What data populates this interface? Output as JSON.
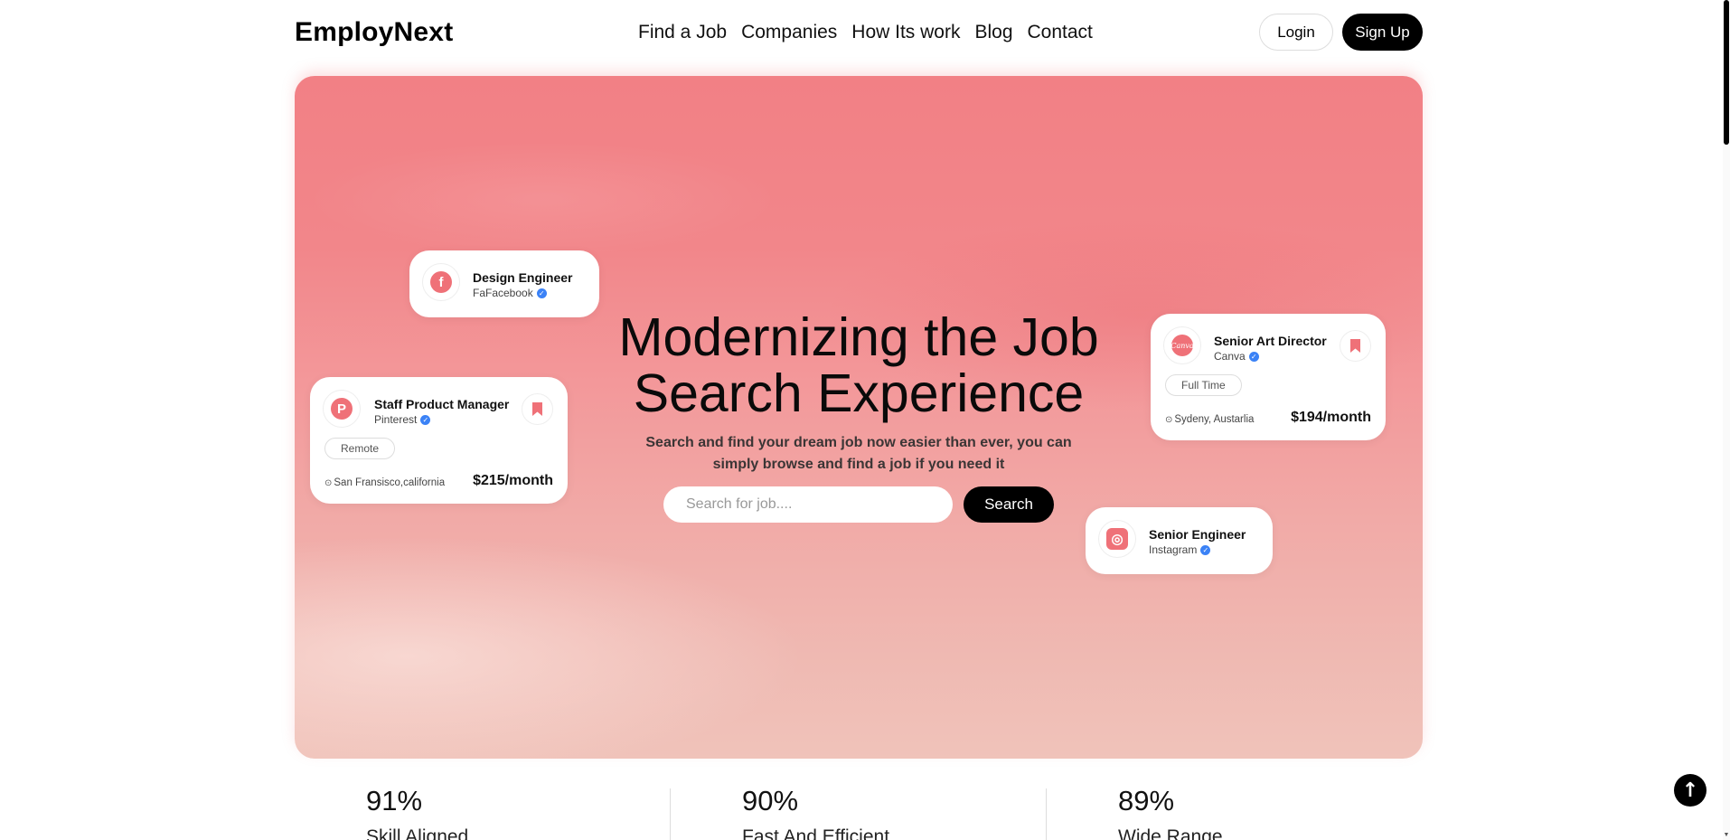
{
  "header": {
    "logo": "EmployNext",
    "nav": [
      "Find a Job",
      "Companies",
      "How Its work",
      "Blog",
      "Contact"
    ],
    "login_label": "Login",
    "signup_label": "Sign Up"
  },
  "hero": {
    "title_line1": "Modernizing the Job",
    "title_line2": "Search Experience",
    "subtitle_line1": "Search and find your dream job now easier than ever, you can",
    "subtitle_line2": "simply browse and find a job if you need it",
    "search_placeholder": "Search for job....",
    "search_label": "Search"
  },
  "cards": {
    "design": {
      "title": "Design Engineer",
      "company": "FaFacebook",
      "logo_icon": "facebook-icon",
      "logo_text": "f"
    },
    "staff": {
      "title": "Staff Product Manager",
      "company": "Pinterest",
      "logo_icon": "pinterest-icon",
      "logo_text": "P",
      "tag": "Remote",
      "location": "San Fransisco,california",
      "salary": "$215/month"
    },
    "art": {
      "title": "Senior Art Director",
      "company": "Canva",
      "logo_icon": "canva-icon",
      "logo_text": "Canva",
      "tag": "Full Time",
      "location": "Sydeny, Austarlia",
      "salary": "$194/month"
    },
    "engineer": {
      "title": "Senior Engineer",
      "company": "Instagram",
      "logo_icon": "instagram-icon",
      "logo_text": "◎"
    }
  },
  "stats": [
    {
      "value": "91%",
      "label": "Skill Aligned"
    },
    {
      "value": "90%",
      "label": "Fast And Efficient"
    },
    {
      "value": "89%",
      "label": "Wide Range"
    }
  ],
  "colors": {
    "accent": "#ef7178",
    "verified": "#3b82f6",
    "primary_button": "#000000"
  },
  "icons": {
    "scroll_top": "arrow-up-icon",
    "verified": "verified-badge-icon",
    "bookmark": "bookmark-icon",
    "location": "location-pin-icon"
  }
}
